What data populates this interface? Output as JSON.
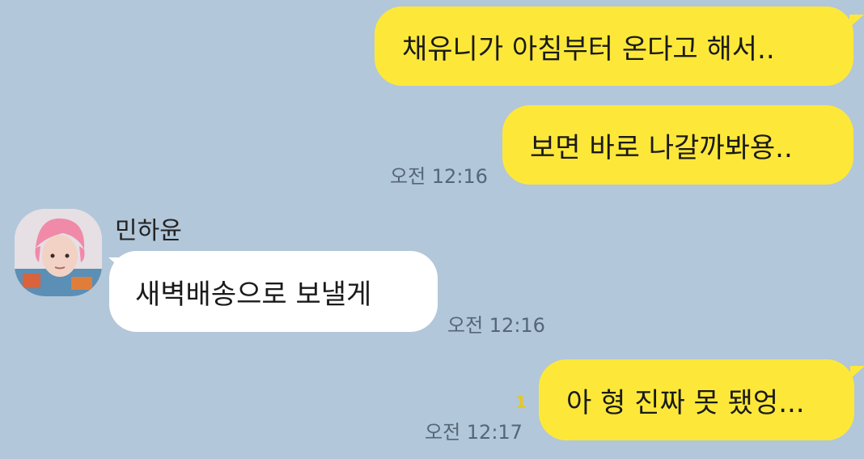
{
  "messages": [
    {
      "text": "채유니가 아침부터 온다고 해서.."
    },
    {
      "text": "보면 바로 나갈까봐용..",
      "time": "오전 12:16"
    },
    {
      "sender": "민하윤",
      "text": "새벽배송으로 보낼게",
      "time": "오전 12:16",
      "avatar": "profile-photo-pink-hair"
    },
    {
      "text": "아 형 진짜 못 됐엉...",
      "time": "오전 12:17",
      "unread": "1"
    }
  ],
  "colors": {
    "background": "#b2c7d9",
    "my_bubble": "#fde83a",
    "their_bubble": "#ffffff",
    "unread": "#e6c81f"
  }
}
